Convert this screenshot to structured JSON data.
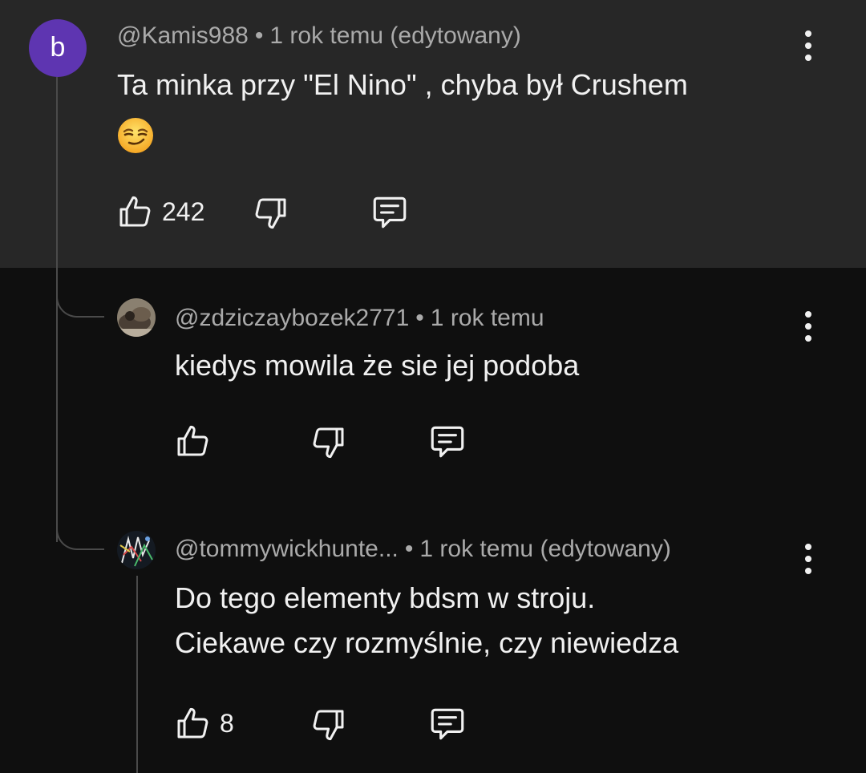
{
  "comments": [
    {
      "author": "@Kamis988",
      "separator": "•",
      "time": "1 rok temu (edytowany)",
      "avatar_letter": "b",
      "avatar_color": "#5e35b1",
      "text_lines": [
        "Ta minka przy \"El Nino\" , chyba był Crushem"
      ],
      "emoji": "smirking-face",
      "likes": "242",
      "highlighted": true
    },
    {
      "author": "@zdziczaybozek2771",
      "separator": "•",
      "time": "1 rok temu",
      "text_lines": [
        "kiedys mowila że sie jej podoba"
      ],
      "likes": ""
    },
    {
      "author": "@tommywickhunte...",
      "separator": "•",
      "time": "1 rok temu (edytowany)",
      "text_lines": [
        "Do tego elementy bdsm w stroju.",
        "Ciekawe czy rozmyślnie, czy niewiedza"
      ],
      "likes": "8"
    }
  ],
  "icons": {
    "like": "thumb-up-icon",
    "dislike": "thumb-down-icon",
    "reply": "comment-icon",
    "menu": "more-vertical-icon"
  },
  "colors": {
    "background": "#0f0f0f",
    "highlight_background": "#272727",
    "text": "#f1f1f1",
    "meta_text": "#aaaaaa",
    "thread_line": "#4a4a4a"
  }
}
